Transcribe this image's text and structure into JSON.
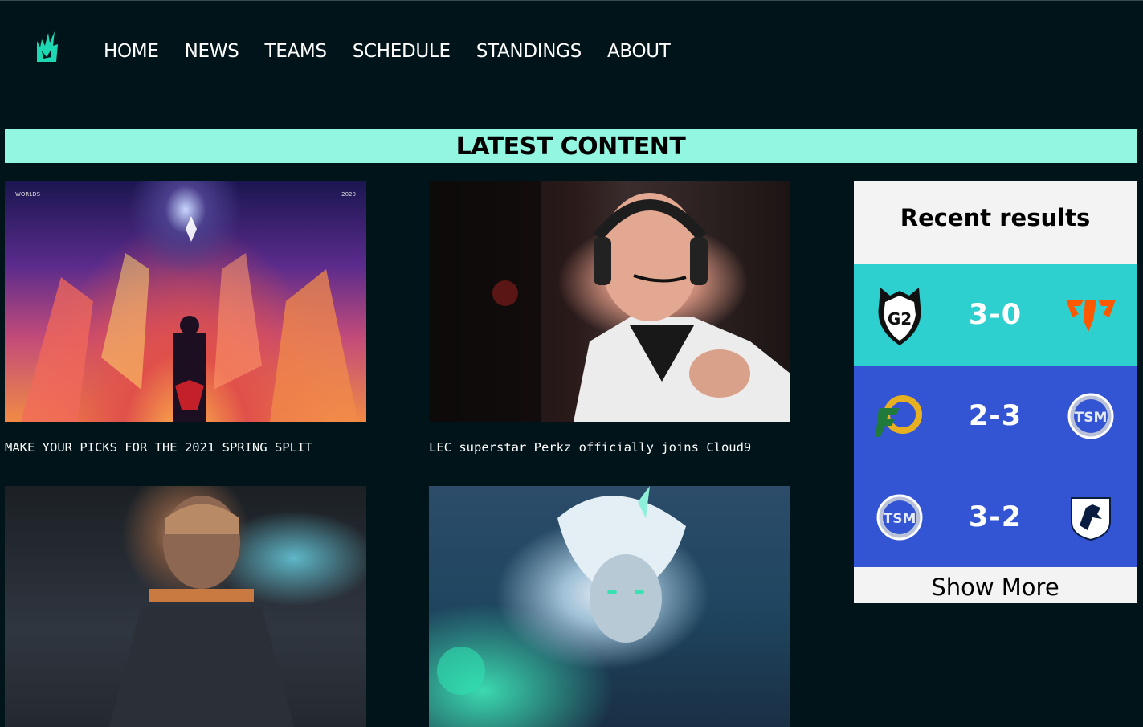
{
  "nav": {
    "logo": "lec-logo-icon",
    "items": [
      {
        "label": "HOME"
      },
      {
        "label": "NEWS"
      },
      {
        "label": "TEAMS"
      },
      {
        "label": "SCHEDULE"
      },
      {
        "label": "STANDINGS"
      },
      {
        "label": "ABOUT"
      }
    ]
  },
  "content": {
    "heading": "LATEST CONTENT",
    "articles": [
      {
        "caption": "MAKE YOUR PICKS FOR THE 2021 SPRING SPLIT",
        "image": "worlds-2020-artwork",
        "image_text_tl": "WORLDS",
        "image_text_tr": "2020"
      },
      {
        "caption": "LEC superstar Perkz officially joins Cloud9",
        "image": "player-with-headset-photo"
      },
      {
        "caption": "",
        "image": "player-back-photo"
      },
      {
        "caption": "",
        "image": "champion-artwork"
      }
    ]
  },
  "results": {
    "title": "Recent results",
    "matches": [
      {
        "home": "g2-logo",
        "score": "3-0",
        "away": "fnatic-logo"
      },
      {
        "home": "flyquest-logo",
        "score": "2-3",
        "away": "tsm-logo"
      },
      {
        "home": "tsm-logo",
        "score": "3-2",
        "away": "team-liquid-logo"
      }
    ],
    "show_more": "Show More"
  },
  "colors": {
    "background": "#01141a",
    "banner": "#93f6e1",
    "row_cyan": "#2dcfcf",
    "row_blue": "#3355d3",
    "logo_accent": "#1ed8b4"
  }
}
